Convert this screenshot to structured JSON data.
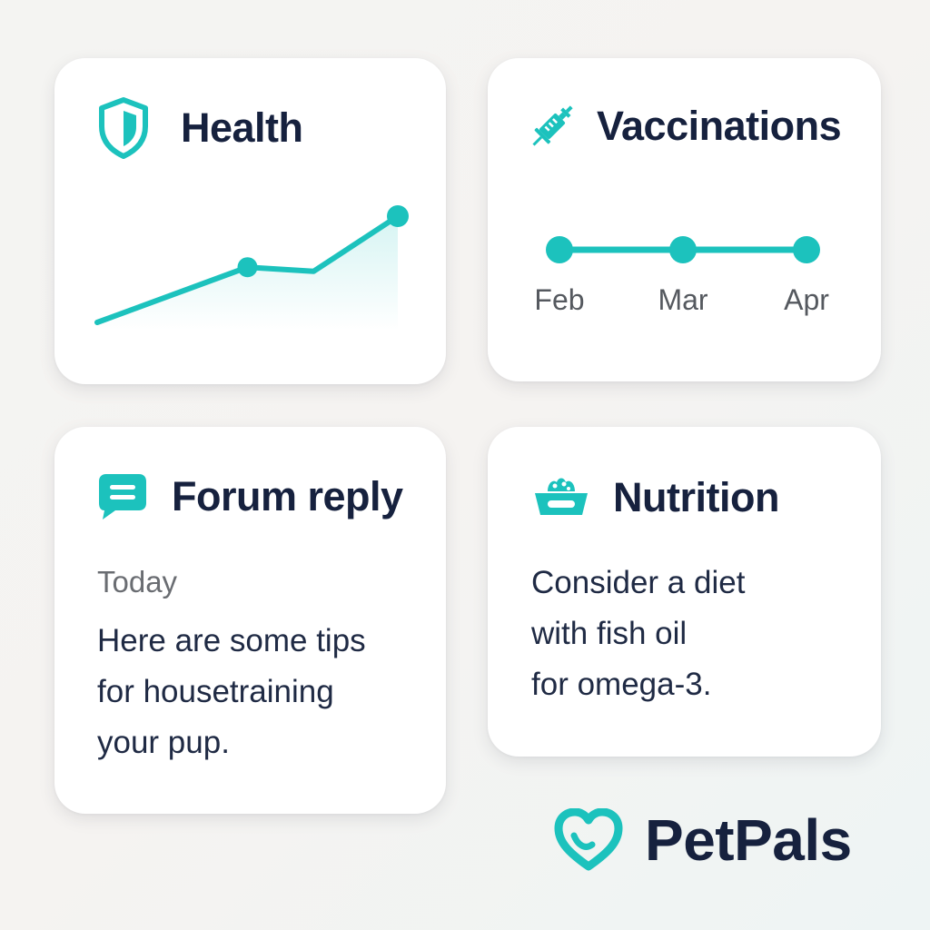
{
  "colors": {
    "accent": "#1cc2bd",
    "title_text": "#16213e",
    "body_text": "#1f2a44",
    "muted_text": "#6a6d72"
  },
  "health": {
    "title": "Health",
    "icon": "shield-icon",
    "trend_points": [
      [
        0,
        0
      ],
      [
        1,
        0.52
      ],
      [
        1.44,
        0.48
      ],
      [
        2,
        1.0
      ]
    ]
  },
  "vaccinations": {
    "title": "Vaccinations",
    "icon": "syringe-icon",
    "months": [
      "Feb",
      "Mar",
      "Apr"
    ]
  },
  "forum": {
    "title": "Forum reply",
    "icon": "chat-bubble-icon",
    "date": "Today",
    "lines": [
      "Here are some tips",
      "for housetraining",
      "your pup."
    ]
  },
  "nutrition": {
    "title": "Nutrition",
    "icon": "food-bowl-icon",
    "lines": [
      "Consider a diet",
      "with fish oil",
      "for omega-3."
    ]
  },
  "brand": {
    "name": "PetPals",
    "icon": "heart-logo-icon"
  }
}
